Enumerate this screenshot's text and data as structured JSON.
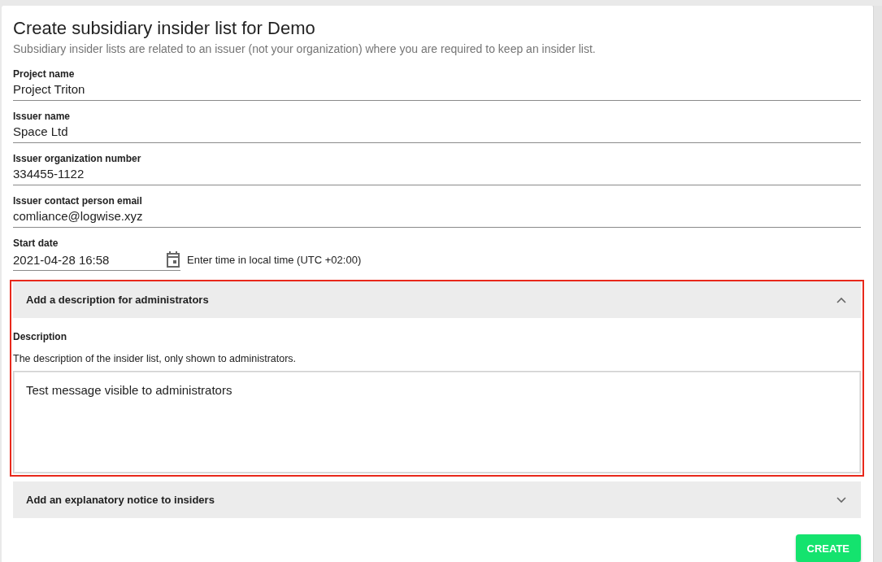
{
  "title": "Create subsidiary insider list for Demo",
  "subtitle": "Subsidiary insider lists are related to an issuer (not your organization) where you are required to keep an insider list.",
  "fields": [
    {
      "label": "Project name",
      "value": "Project Triton"
    },
    {
      "label": "Issuer name",
      "value": "Space Ltd"
    },
    {
      "label": "Issuer organization number",
      "value": "334455-1122"
    },
    {
      "label": "Issuer contact person email",
      "value": "comliance@logwise.xyz"
    }
  ],
  "start_date": {
    "label": "Start date",
    "value": "2021-04-28 16:58",
    "hint": "Enter time in local time (UTC +02:00)"
  },
  "sections": [
    {
      "title": "Add a description for administrators",
      "expanded": true,
      "highlighted": true,
      "field_label": "Description",
      "help": "The description of the insider list, only shown to administrators.",
      "value": "Test message visible to administrators"
    },
    {
      "title": "Add an explanatory notice to insiders",
      "expanded": false,
      "highlighted": false
    }
  ],
  "button": "CREATE"
}
